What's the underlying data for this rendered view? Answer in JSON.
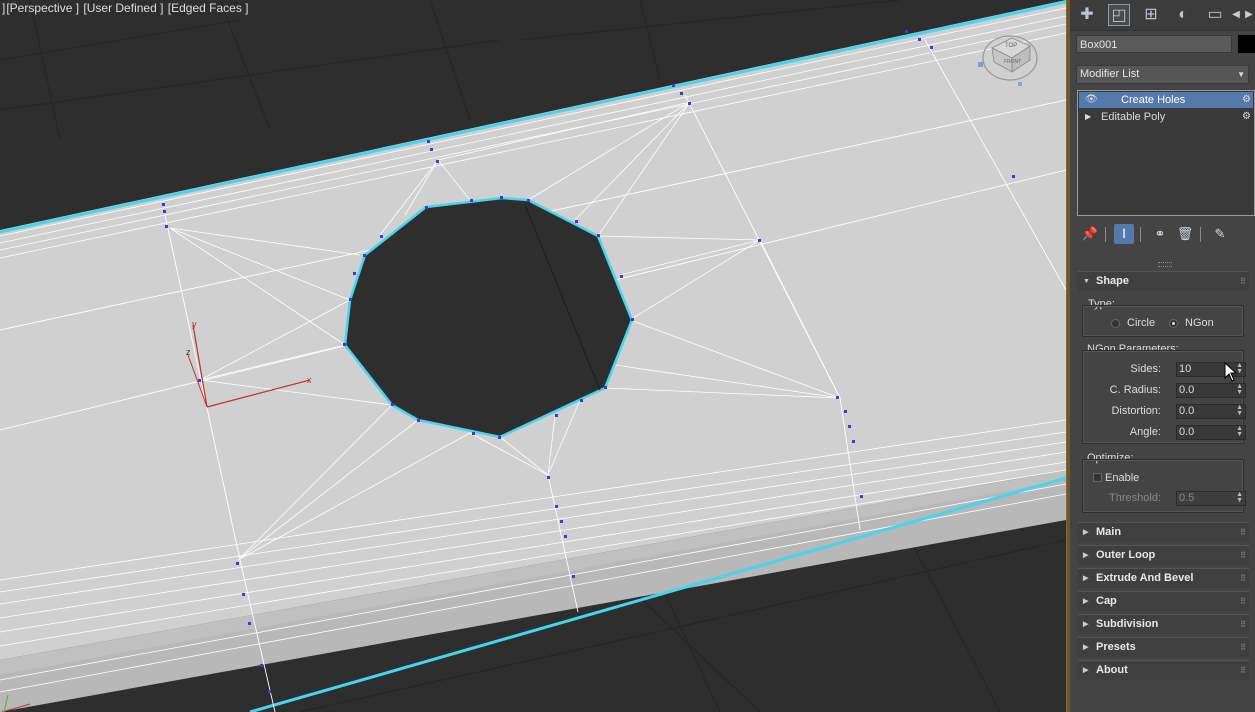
{
  "viewport": {
    "labels": [
      "]",
      "[Perspective ]",
      "[User Defined ]",
      "[Edged Faces ]"
    ],
    "axis": {
      "x": "x",
      "y": "y",
      "z": "z"
    },
    "viewcube": {
      "top": "TOP",
      "front": "FRONT"
    }
  },
  "panel": {
    "tabs": [
      "create-icon",
      "modify-icon",
      "hierarchy-icon",
      "motion-icon",
      "display-icon",
      "scroll-left-icon",
      "scroll-right-icon"
    ],
    "object_name": "Box001",
    "object_color": "#000000",
    "modifier_list_label": "Modifier List",
    "stack": [
      {
        "label": "Create Holes",
        "selected": true
      },
      {
        "label": "Editable Poly",
        "selected": false
      }
    ],
    "shape": {
      "title": "Shape",
      "type_label": "Type:",
      "type_options": [
        "Circle",
        "NGon"
      ],
      "type_selected": "NGon",
      "ngon_label": "NGon Parameters:",
      "params": [
        {
          "label": "Sides:",
          "value": "10"
        },
        {
          "label": "C. Radius:",
          "value": "0.0"
        },
        {
          "label": "Distortion:",
          "value": "0.0"
        },
        {
          "label": "Angle:",
          "value": "0.0"
        }
      ],
      "optimize_label": "Optimize:",
      "enable_label": "Enable",
      "threshold_label": "Threshold:",
      "threshold_value": "0.5"
    },
    "rollouts": [
      "Main",
      "Outer Loop",
      "Extrude And Bevel",
      "Cap",
      "Subdivision",
      "Presets",
      "About"
    ]
  }
}
